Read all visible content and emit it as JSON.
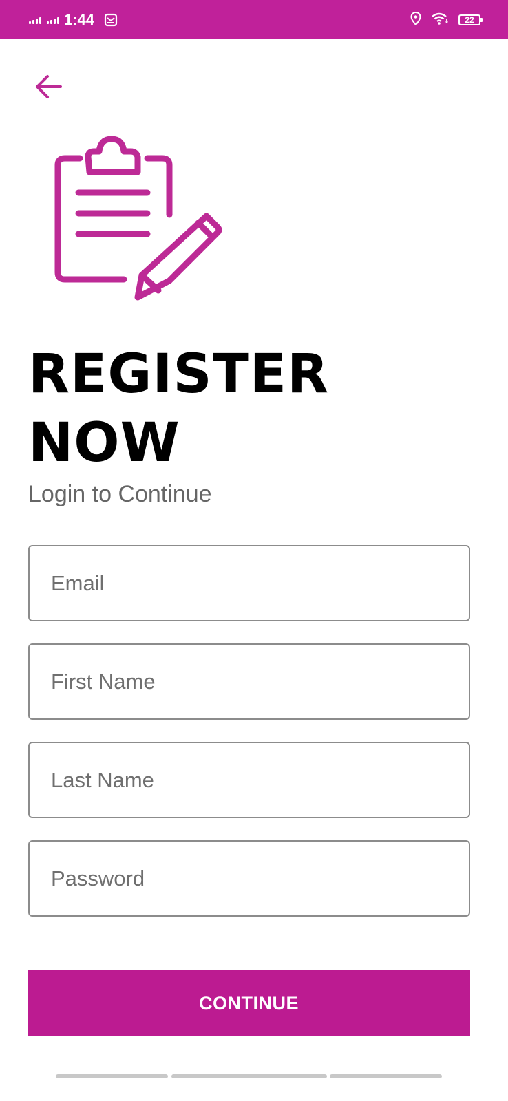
{
  "status_bar": {
    "time": "1:44",
    "battery": "22",
    "background": "#c0219a",
    "icons": [
      "signal-icon",
      "signal-icon",
      "message-icon",
      "location-icon",
      "wifi-icon",
      "battery-icon"
    ]
  },
  "header": {
    "back_icon": "arrow-left-icon",
    "accent": "#bd2a96"
  },
  "hero": {
    "icon": "clipboard-pencil-icon"
  },
  "page": {
    "title": "REGISTER NOW",
    "subtitle": "Login to Continue"
  },
  "form": {
    "email_placeholder": "Email",
    "first_name_placeholder": "First Name",
    "last_name_placeholder": "Last Name",
    "password_placeholder": "Password",
    "email_value": "",
    "first_name_value": "",
    "last_name_value": "",
    "password_value": ""
  },
  "actions": {
    "continue_label": "CONTINUE",
    "button_color": "#bc1b91"
  }
}
